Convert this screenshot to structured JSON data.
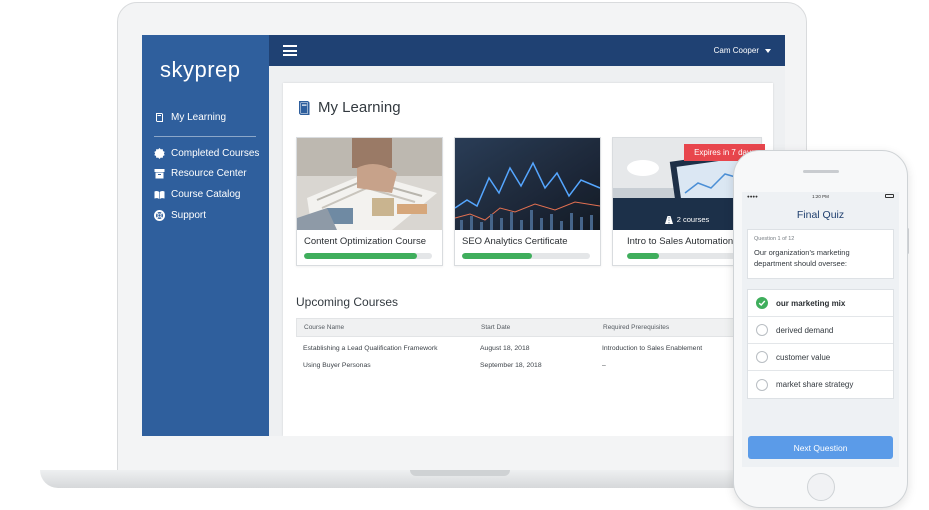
{
  "app": {
    "logo_text": "skyprep"
  },
  "sidebar": {
    "items": [
      {
        "label": "My Learning",
        "icon": "book-icon"
      },
      {
        "label": "Completed Courses",
        "icon": "badge-icon"
      },
      {
        "label": "Resource Center",
        "icon": "archive-icon"
      },
      {
        "label": "Course Catalog",
        "icon": "open-book-icon"
      },
      {
        "label": "Support",
        "icon": "lifebuoy-icon"
      }
    ]
  },
  "header": {
    "user_name": "Cam Cooper"
  },
  "main": {
    "title": "My Learning",
    "courses": [
      {
        "title": "Content Optimization Course",
        "progress": 0.88
      },
      {
        "title": "SEO Analytics Certificate",
        "progress": 0.55
      },
      {
        "title": "Intro to Sales Automation",
        "progress": 0.25,
        "badge": "Expires in 7 days",
        "course_count": "2 courses"
      }
    ],
    "upcoming": {
      "title": "Upcoming Courses",
      "columns": [
        "Course Name",
        "Start Date",
        "Required Prerequisites"
      ],
      "rows": [
        [
          "Establishing a Lead Qualification Framework",
          "August 18, 2018",
          "Introduction to Sales Enablement"
        ],
        [
          "Using Buyer Personas",
          "September 18, 2018",
          "–"
        ]
      ]
    }
  },
  "phone": {
    "time": "1:20 PM",
    "quiz_title": "Final Quiz",
    "question_counter": "Question 1 of 12",
    "question": "Our organization's marketing department should oversee:",
    "answers": [
      "our marketing mix",
      "derived demand",
      "customer value",
      "market share strategy"
    ],
    "selected_answer": "our marketing mix",
    "next_label": "Next Question"
  },
  "colors": {
    "sidebar": "#2f5f9d",
    "topbar": "#1f4173",
    "progress": "#3fae5c",
    "expires_badge": "#e8464d",
    "primary_button": "#5b9be8"
  }
}
